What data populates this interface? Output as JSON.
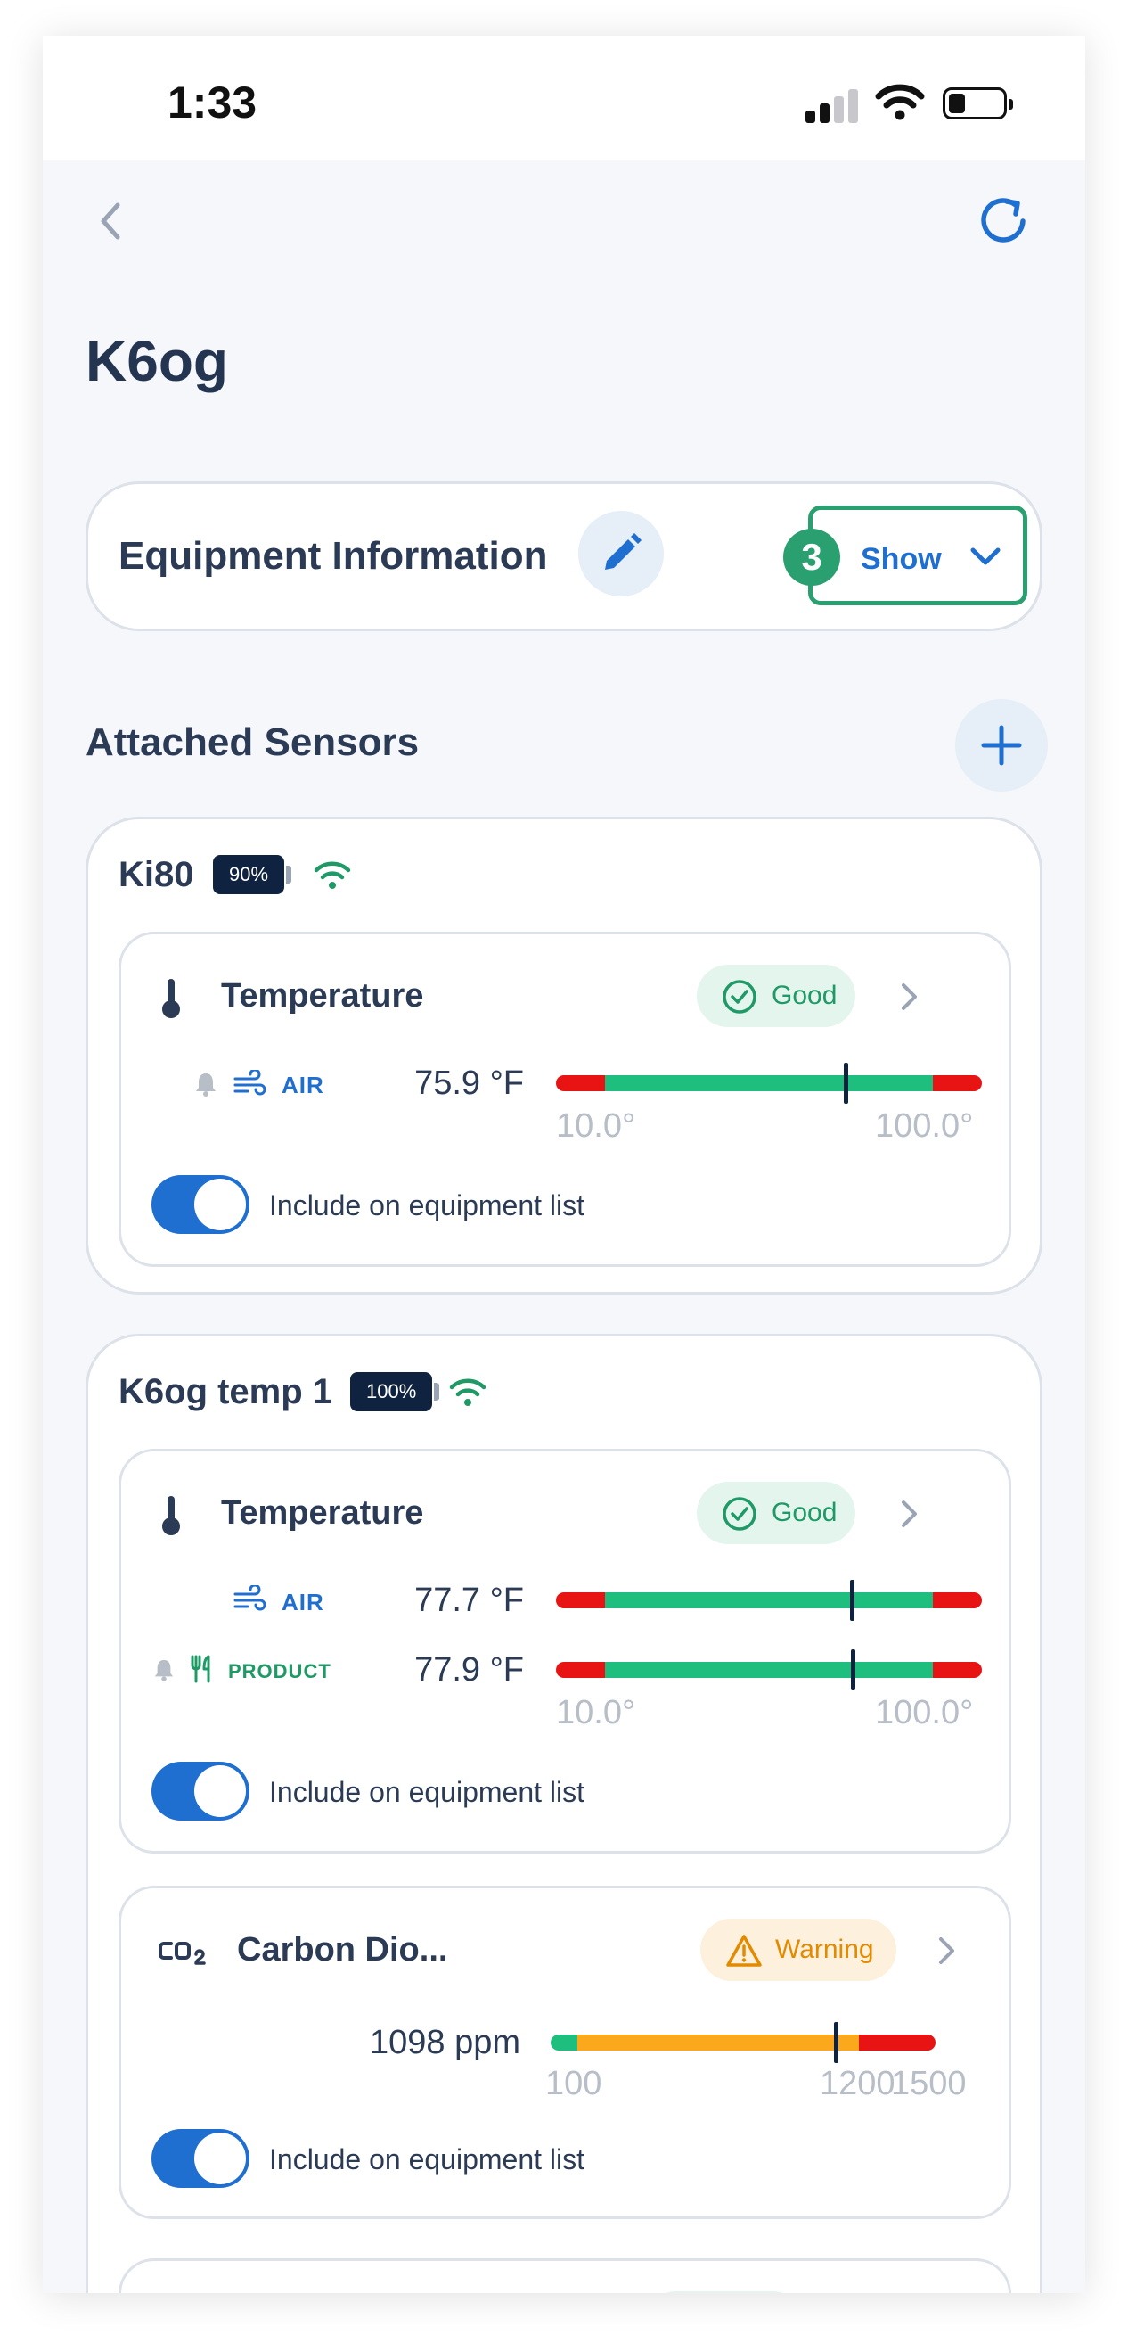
{
  "status_bar": {
    "time": "1:33"
  },
  "page": {
    "title": "K6og"
  },
  "equipment": {
    "title": "Equipment Information",
    "show_label": "Show",
    "step_badge": "3"
  },
  "sensors_section": {
    "title": "Attached Sensors"
  },
  "sensors": [
    {
      "name": "Ki80",
      "battery": "90%",
      "readings": [
        {
          "title": "Temperature",
          "status": "Good",
          "rows": [
            {
              "label": "AIR",
              "value": "75.9 °F",
              "level": 0.68
            }
          ],
          "min_label": "10.0°",
          "max_label": "100.0°",
          "toggle_label": "Include on equipment list"
        }
      ]
    },
    {
      "name": "K6og temp 1",
      "battery": "100%",
      "readings": [
        {
          "title": "Temperature",
          "status": "Good",
          "rows": [
            {
              "label": "AIR",
              "value": "77.7 °F",
              "level": 0.695
            },
            {
              "label": "PRODUCT",
              "value": "77.9 °F",
              "level": 0.697
            }
          ],
          "min_label": "10.0°",
          "max_label": "100.0°",
          "toggle_label": "Include on equipment list"
        },
        {
          "title": "Carbon Dio...",
          "status": "Warning",
          "rows": [
            {
              "label": "",
              "value": "1098 ppm",
              "level": 0.74
            }
          ],
          "min_label": "100",
          "mid_label": "1200",
          "max_label": "1500",
          "toggle_label": "Include on equipment list"
        }
      ]
    }
  ],
  "colors": {
    "accent": "#1f6fd1",
    "good": "#1f9a66",
    "warning": "#e38b00",
    "gauge_green": "#1ebf7e",
    "gauge_red": "#e81414",
    "gauge_orange": "#fba81c"
  }
}
